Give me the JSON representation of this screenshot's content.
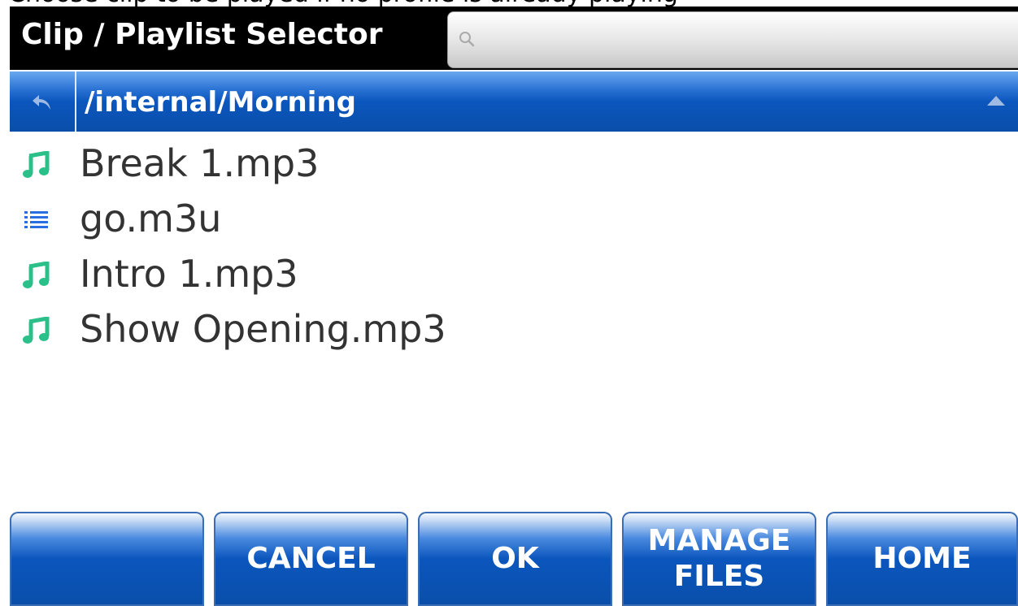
{
  "window": {
    "caption": "Choose clip to be played if no profile is already playing",
    "title": "Clip / Playlist Selector"
  },
  "search": {
    "value": "",
    "placeholder": ""
  },
  "pathbar": {
    "path": "/internal/Morning"
  },
  "files": [
    {
      "name": "Break 1.mp3",
      "icon": "music-note-icon",
      "color": "#2bbf8a"
    },
    {
      "name": "go.m3u",
      "icon": "playlist-icon",
      "color": "#2a6fe0"
    },
    {
      "name": "Intro 1.mp3",
      "icon": "music-note-icon",
      "color": "#2bbf8a"
    },
    {
      "name": "Show Opening.mp3",
      "icon": "music-note-icon",
      "color": "#2bbf8a"
    }
  ],
  "toolbar": {
    "blank_label": "",
    "cancel_label": "CANCEL",
    "ok_label": "OK",
    "manage_files_label": "MANAGE\nFILES",
    "home_label": "HOME"
  },
  "colors": {
    "accent": "#0b56bd",
    "titlebar": "#000000",
    "text": "#333333"
  }
}
